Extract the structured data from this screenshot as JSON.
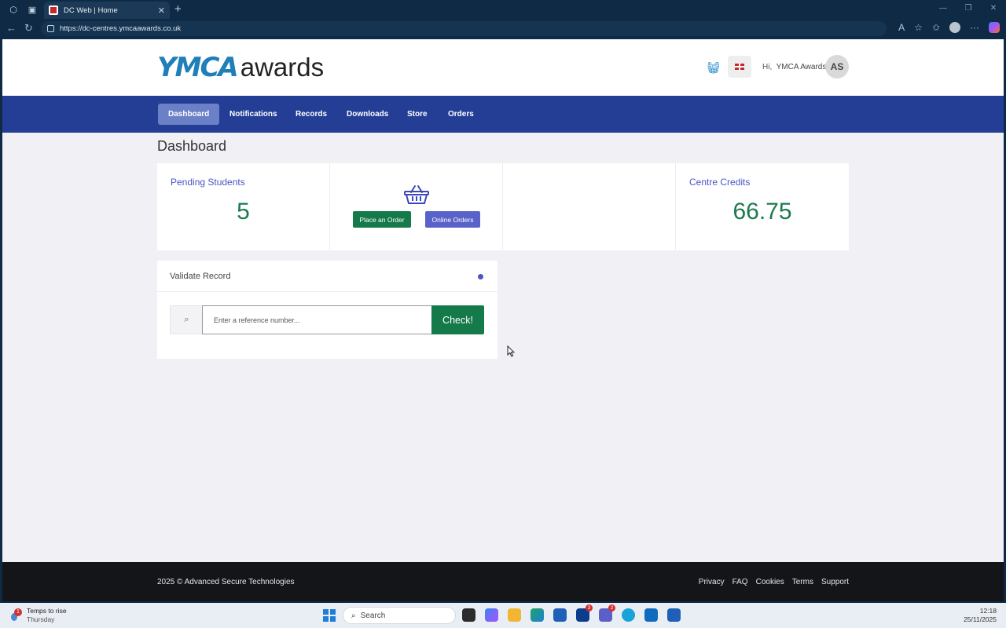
{
  "browser": {
    "tab_title": "DC Web | Home",
    "url": "https://dc-centres.ymcaawards.co.uk"
  },
  "header": {
    "logo_ymca": "YMCA",
    "logo_awards": "awards",
    "greeting": "Hi,",
    "user_name": "YMCA Awards",
    "avatar_initials": "AS"
  },
  "nav": {
    "items": [
      {
        "label": "Dashboard"
      },
      {
        "label": "Notifications"
      },
      {
        "label": "Records"
      },
      {
        "label": "Downloads"
      },
      {
        "label": "Store"
      },
      {
        "label": "Orders"
      }
    ]
  },
  "page": {
    "title": "Dashboard"
  },
  "cards": {
    "pending_label": "Pending Students",
    "pending_value": "5",
    "place_order": "Place an Order",
    "online_orders": "Online Orders",
    "credits_label": "Centre Credits",
    "credits_value": "66.75"
  },
  "validate": {
    "title": "Validate Record",
    "placeholder": "Enter a reference number...",
    "check_label": "Check!"
  },
  "footer": {
    "copyright": "2025 © Advanced Secure Technologies",
    "links": [
      "Privacy",
      "FAQ",
      "Cookies",
      "Terms",
      "Support"
    ]
  },
  "taskbar": {
    "weather_line1": "Temps to rise",
    "weather_line2": "Thursday",
    "weather_badge": "1",
    "search_label": "Search",
    "time": "12:18",
    "date": "25/11/2025",
    "badge_a": "3",
    "badge_b": "2"
  },
  "colors": {
    "nav_bg": "#243e96",
    "nav_active": "#6b80c7",
    "accent_green": "#157a4a",
    "accent_purple": "#5962c9",
    "label_blue": "#4a55c2",
    "footer_bg": "#141518"
  }
}
